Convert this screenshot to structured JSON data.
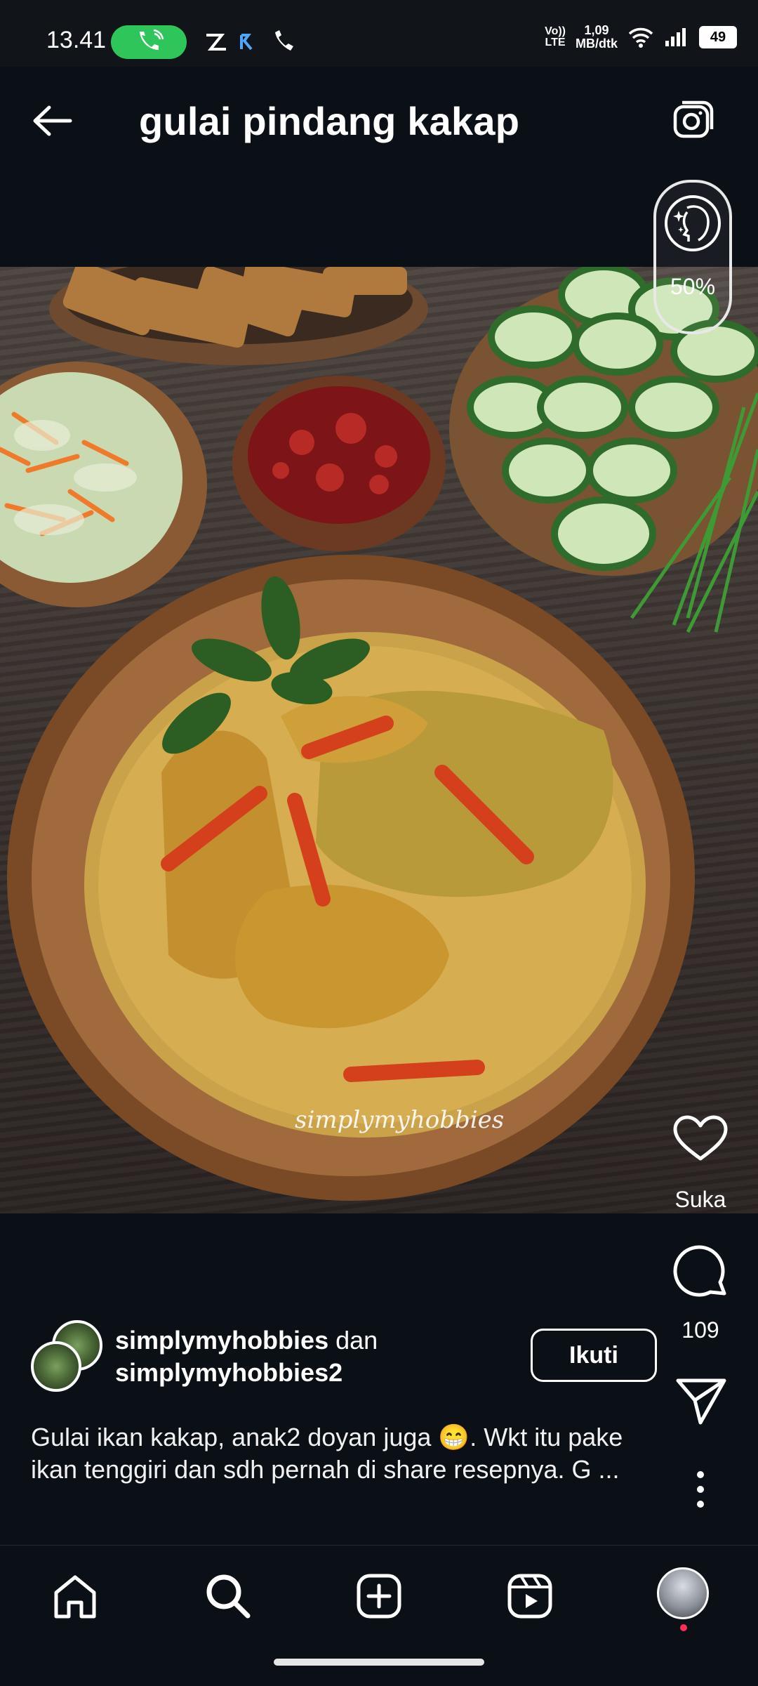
{
  "status_bar": {
    "time": "13.41",
    "network_top": "1,09",
    "network_bottom": "MB/dtk",
    "volte": "Vo))",
    "lte": "LTE",
    "battery": "49"
  },
  "header": {
    "title": "gulai pindang kakap"
  },
  "beauty_filter": {
    "percent": "50%"
  },
  "photo": {
    "watermark": "simplymyhobbies"
  },
  "actions": {
    "like_label": "Suka",
    "comments_count": "109"
  },
  "post": {
    "author1": "simplymyhobbies",
    "conjunction": "dan",
    "author2": "simplymyhobbies2",
    "follow_label": "Ikuti",
    "caption": "Gulai ikan kakap, anak2 doyan juga 😁. Wkt itu pake ikan tenggiri dan sdh pernah di share resepnya. G ..."
  },
  "icons": {
    "back": "arrow-left-icon",
    "camera": "camera-icon",
    "like": "heart-icon",
    "comment": "comment-icon",
    "share": "send-icon",
    "more": "more-vertical-icon",
    "home": "home-icon",
    "search": "search-icon",
    "add": "add-post-icon",
    "reels": "reels-icon",
    "profile": "profile-avatar"
  },
  "colors": {
    "background": "#0b0f16",
    "call_pill": "#2ec55b",
    "notification_dot": "#ff2d55"
  }
}
